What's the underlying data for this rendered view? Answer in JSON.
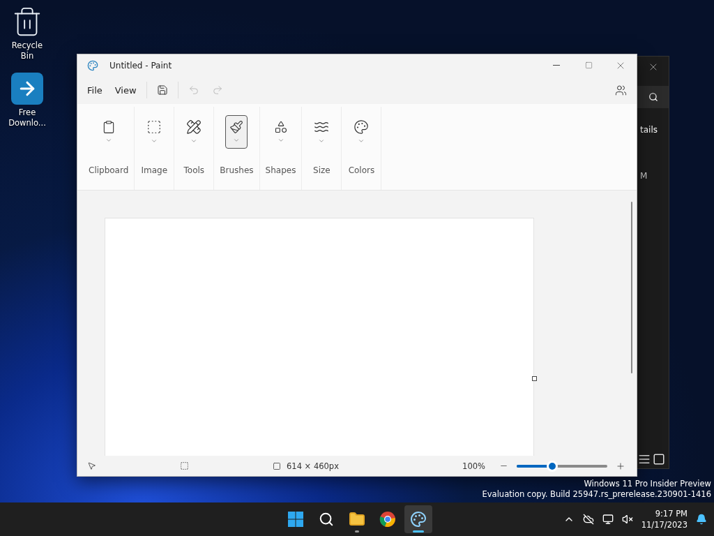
{
  "desktop_icons": [
    {
      "label": "Recycle Bin",
      "kind": "recycle"
    },
    {
      "label": "Free Downlo...",
      "kind": "shortcut"
    }
  ],
  "background_window": {
    "texts": [
      "tails",
      "M"
    ]
  },
  "paint": {
    "title": "Untitled - Paint",
    "menu": [
      "File",
      "View"
    ],
    "quick_actions": [
      {
        "kind": "save",
        "disabled": false
      },
      {
        "kind": "undo",
        "disabled": true
      },
      {
        "kind": "redo",
        "disabled": true
      }
    ],
    "ribbon": [
      {
        "label": "Clipboard",
        "kind": "clipboard",
        "selected": false
      },
      {
        "label": "Image",
        "kind": "image",
        "selected": false
      },
      {
        "label": "Tools",
        "kind": "tools",
        "selected": false
      },
      {
        "label": "Brushes",
        "kind": "brushes",
        "selected": true
      },
      {
        "label": "Shapes",
        "kind": "shapes",
        "selected": false
      },
      {
        "label": "Size",
        "kind": "size",
        "selected": false
      },
      {
        "label": "Colors",
        "kind": "colors",
        "selected": false
      }
    ],
    "canvas_size": "614 × 460px",
    "zoom": "100%",
    "zoom_slider": {
      "level": 0.39
    }
  },
  "watermark": [
    "Windows 11 Pro Insider Preview",
    "Evaluation copy. Build 25947.rs_prerelease.230901-1416"
  ],
  "taskbar": {
    "apps": [
      {
        "kind": "start",
        "running": false,
        "selected": false
      },
      {
        "kind": "search",
        "running": false,
        "selected": false
      },
      {
        "kind": "explorer",
        "running": true,
        "selected": false
      },
      {
        "kind": "chrome",
        "running": false,
        "selected": false
      },
      {
        "kind": "paint",
        "running": true,
        "selected": true
      }
    ],
    "time": "9:17 PM",
    "date": "11/17/2023"
  }
}
